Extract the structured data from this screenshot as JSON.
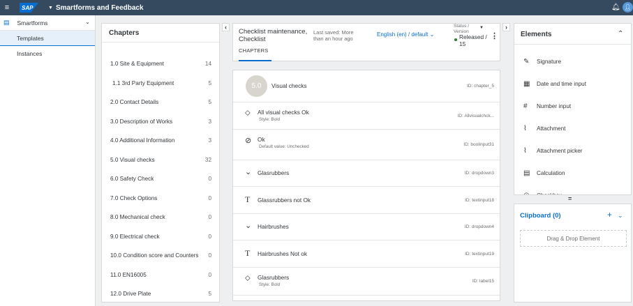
{
  "shell": {
    "logo": "SAP",
    "title": "Smartforms and Feedback"
  },
  "nav": {
    "header_label": "Smartforms",
    "items": [
      {
        "label": "Templates",
        "selected": true
      },
      {
        "label": "Instances",
        "selected": false
      }
    ]
  },
  "chapters": {
    "title": "Chapters",
    "rows": [
      {
        "label": "1.0 Site & Equipment",
        "count": "14"
      },
      {
        "label": "1.1 3rd Party Equipment",
        "count": "5"
      },
      {
        "label": "2.0 Contact Details",
        "count": "5"
      },
      {
        "label": "3.0 Description of Works",
        "count": "3"
      },
      {
        "label": "4.0 Additional Information",
        "count": "3"
      },
      {
        "label": "5.0 Visual checks",
        "count": "32"
      },
      {
        "label": "6.0 Safety Check",
        "count": "0"
      },
      {
        "label": "7.0 Check Options",
        "count": "0"
      },
      {
        "label": "8.0 Mechanical check",
        "count": "0"
      },
      {
        "label": "9.0 Electrical check",
        "count": "0"
      },
      {
        "label": "10.0 Condition score and Counters",
        "count": "0"
      },
      {
        "label": "11.0 EN16005",
        "count": "0"
      },
      {
        "label": "12.0 Drive Plate",
        "count": "5"
      }
    ]
  },
  "header": {
    "title": "Checklist maintenance, Checklist",
    "last_saved": "Last saved: More than an hour ago",
    "language": "English (en) / default",
    "status_label": "Status / Version",
    "status_value": "Released / 15",
    "tab": "CHAPTERS"
  },
  "items": [
    {
      "type": "chapter",
      "number": "5.0",
      "label": "Visual checks",
      "sub": "",
      "id": "ID: chapter_5",
      "icon": "chapter-circle"
    },
    {
      "type": "label",
      "label": "All visual checks Ok",
      "sub": "Style: Bold",
      "id": "ID: Allvisualchck...",
      "icon": "tag-icon"
    },
    {
      "type": "boolean",
      "label": "Ok",
      "sub": "Default value: Unchecked",
      "id": "ID: boolinput31",
      "icon": "check-circle-icon"
    },
    {
      "type": "dropdown",
      "label": "Glasrubbers",
      "sub": "",
      "id": "ID: dropdown3",
      "icon": "chevron-down-icon"
    },
    {
      "type": "text",
      "label": "Glassrubbers not Ok",
      "sub": "",
      "id": "ID: textinput18",
      "icon": "text-icon"
    },
    {
      "type": "dropdown",
      "label": "Hairbrushes",
      "sub": "",
      "id": "ID: dropdown4",
      "icon": "chevron-down-icon"
    },
    {
      "type": "text",
      "label": "Hairbrushes Not ok",
      "sub": "",
      "id": "ID: textinput19",
      "icon": "text-icon"
    },
    {
      "type": "label",
      "label": "Glasrubbers",
      "sub": "Style: Bold",
      "id": "ID: label15",
      "icon": "tag-icon"
    }
  ],
  "elements": {
    "title": "Elements",
    "items": [
      {
        "label": "Signature",
        "icon": "signature-icon"
      },
      {
        "label": "Date and time input",
        "icon": "calendar-icon"
      },
      {
        "label": "Number input",
        "icon": "hash-icon"
      },
      {
        "label": "Attachment",
        "icon": "paperclip-icon"
      },
      {
        "label": "Attachment picker",
        "icon": "paperclip-icon"
      },
      {
        "label": "Calculation",
        "icon": "calculator-icon"
      },
      {
        "label": "Checkbox",
        "icon": "check-circle-icon"
      }
    ]
  },
  "clipboard": {
    "title": "Clipboard (0)",
    "drop_text": "Drag & Drop Element"
  }
}
